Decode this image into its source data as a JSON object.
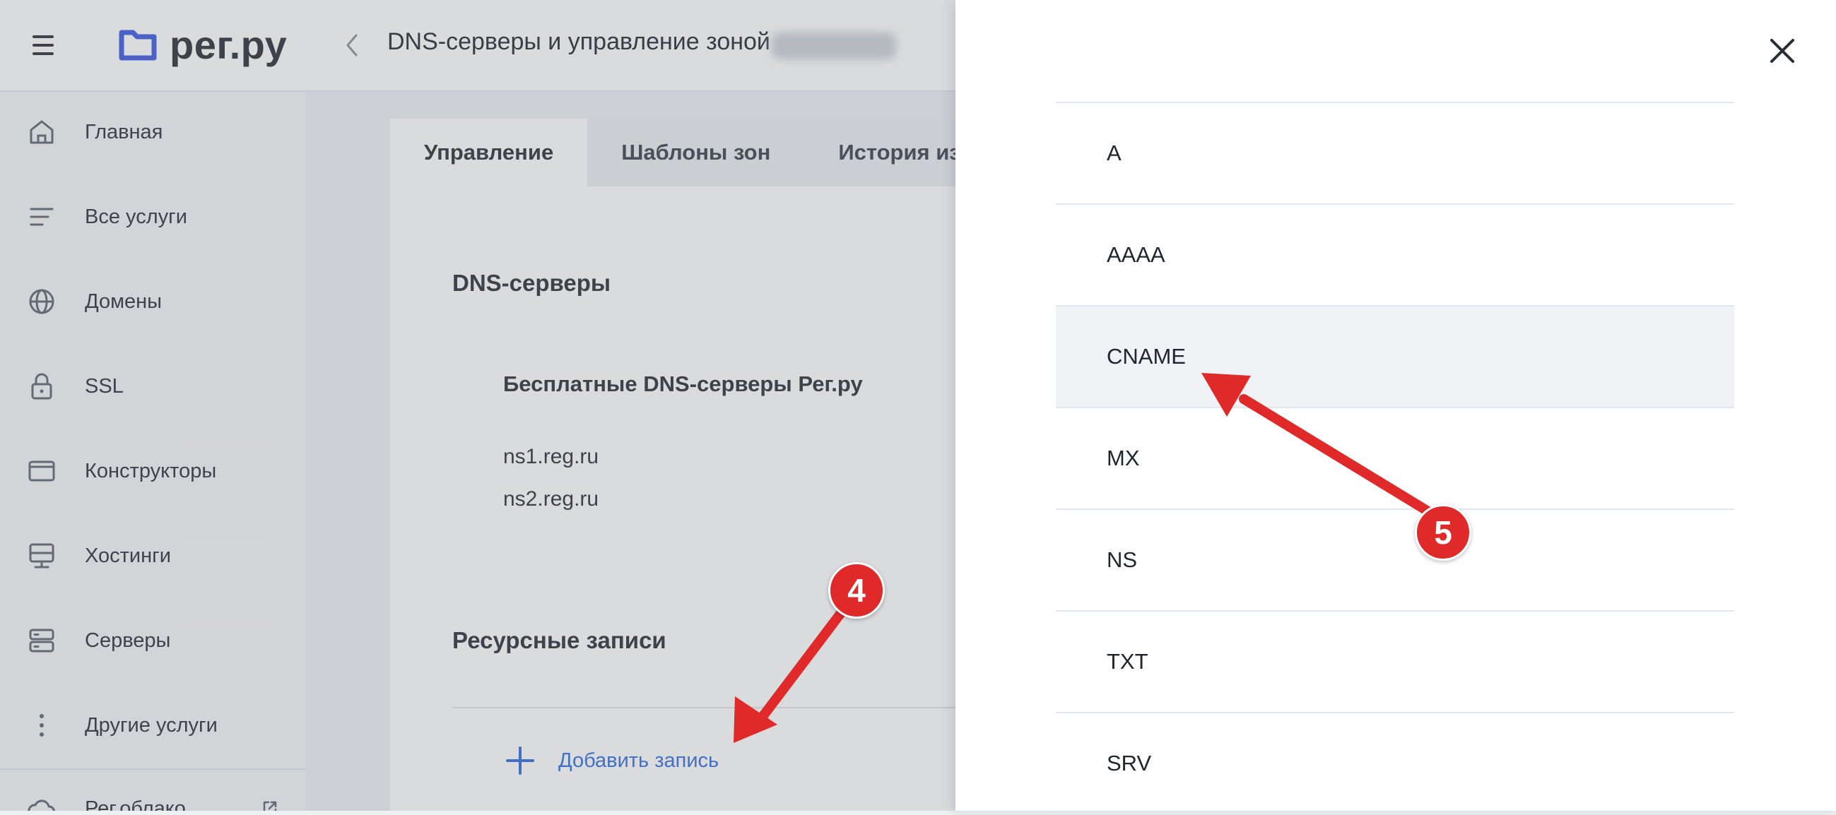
{
  "header": {
    "menu_icon": "hamburger-menu-icon",
    "logo_icon": "folder-logo-icon",
    "logo_text": "рег.ру",
    "back_icon": "chevron-left-icon",
    "title": "DNS-серверы и управление зоной"
  },
  "sidebar": {
    "items": [
      {
        "label": "Главная",
        "icon": "home-icon"
      },
      {
        "label": "Все услуги",
        "icon": "list-icon"
      },
      {
        "label": "Домены",
        "icon": "globe-icon"
      },
      {
        "label": "SSL",
        "icon": "lock-icon"
      },
      {
        "label": "Конструкторы",
        "icon": "browser-window-icon"
      },
      {
        "label": "Хостинги",
        "icon": "hosting-icon"
      },
      {
        "label": "Серверы",
        "icon": "server-icon"
      },
      {
        "label": "Другие услуги",
        "icon": "more-vertical-icon"
      },
      {
        "label": "Рег.облако",
        "icon": "cloud-icon"
      }
    ],
    "external_icon": "external-link-icon"
  },
  "tabs": [
    {
      "label": "Управление",
      "active": true
    },
    {
      "label": "Шаблоны зон",
      "active": false
    },
    {
      "label": "История изм",
      "active": false
    }
  ],
  "main": {
    "dns_section_title": "DNS-серверы",
    "dns_subtitle": "Бесплатные DNS-серверы Рег.ру",
    "nameservers": [
      "ns1.reg.ru",
      "ns2.reg.ru"
    ],
    "records_section_title": "Ресурсные записи",
    "add_record_label": "Добавить запись",
    "add_icon": "plus-icon"
  },
  "panel": {
    "close_icon": "close-icon",
    "record_types": [
      "A",
      "AAAA",
      "CNAME",
      "MX",
      "NS",
      "TXT",
      "SRV"
    ],
    "highlighted": "CNAME"
  },
  "annotations": {
    "badges": [
      "4",
      "5"
    ],
    "arrow_color": "#e02a2a"
  },
  "colors": {
    "brand": "#3a56e0",
    "link": "#2f6bde",
    "accent_red": "#e02a2a"
  }
}
